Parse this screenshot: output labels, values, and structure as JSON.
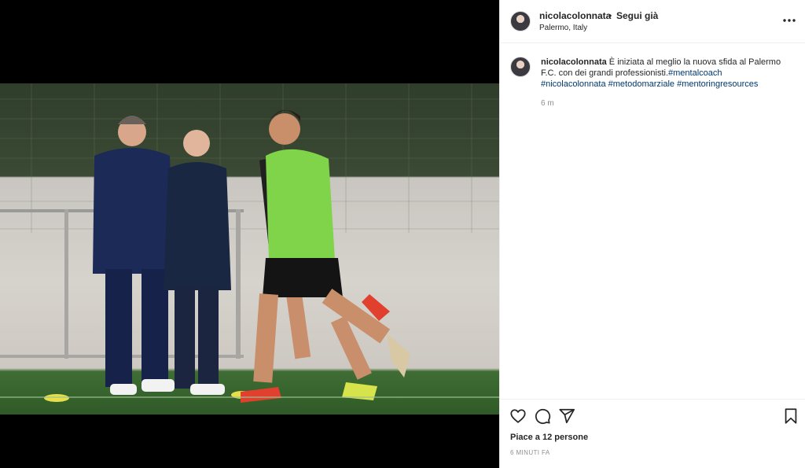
{
  "post": {
    "username": "nicolacolonnata",
    "separator": "•",
    "follow_label": "Segui già",
    "location": "Palermo, Italy",
    "more_icon": "more-horizontal-icon",
    "caption": {
      "username": "nicolacolonnata",
      "text": " È iniziata al meglio la nuova sfida al Palermo F.C. con dei grandi professionisti.",
      "hashtags": [
        "#mentalcoach",
        "#nicolacolonnata",
        "#metodomarziale",
        "#mentoringresources"
      ]
    },
    "caption_time": "6 m",
    "likes": "Piace a 12 persone",
    "timestamp": "6 MINUTI FA",
    "actions": {
      "like_icon": "heart-icon",
      "comment_icon": "comment-icon",
      "share_icon": "share-icon",
      "save_icon": "bookmark-icon"
    },
    "colors": {
      "link": "#00376b",
      "muted": "#8e8e8e",
      "text": "#262626"
    }
  }
}
